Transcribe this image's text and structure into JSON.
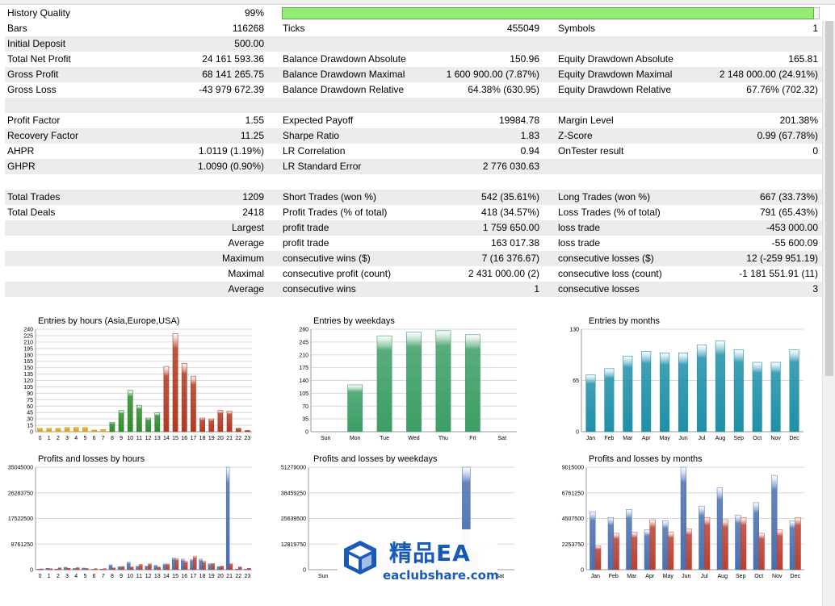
{
  "report": {
    "history_quality": {
      "label": "History Quality",
      "value": "99%",
      "fraction": 0.99
    },
    "rows": [
      {
        "shade": false,
        "c": [
          [
            "Bars",
            "116268"
          ],
          [
            "Ticks",
            "455049"
          ],
          [
            "Symbols",
            "1"
          ]
        ]
      },
      {
        "shade": true,
        "c": [
          [
            "Initial Deposit",
            "500.00"
          ],
          [
            "",
            ""
          ],
          [
            "",
            ""
          ]
        ]
      },
      {
        "shade": false,
        "c": [
          [
            "Total Net Profit",
            "24 161 593.36"
          ],
          [
            "Balance Drawdown Absolute",
            "150.96"
          ],
          [
            "Equity Drawdown Absolute",
            "165.81"
          ]
        ]
      },
      {
        "shade": true,
        "c": [
          [
            "Gross Profit",
            "68 141 265.75"
          ],
          [
            "Balance Drawdown Maximal",
            "1 600 900.00 (7.87%)"
          ],
          [
            "Equity Drawdown Maximal",
            "2 148 000.00 (24.91%)"
          ]
        ]
      },
      {
        "shade": false,
        "c": [
          [
            "Gross Loss",
            "-43 979 672.39"
          ],
          [
            "Balance Drawdown Relative",
            "64.38% (630.95)"
          ],
          [
            "Equity Drawdown Relative",
            "67.76% (702.32)"
          ]
        ]
      },
      {
        "shade": true,
        "blank": true,
        "c": []
      },
      {
        "shade": false,
        "c": [
          [
            "Profit Factor",
            "1.55"
          ],
          [
            "Expected Payoff",
            "19984.78"
          ],
          [
            "Margin Level",
            "201.38%"
          ]
        ]
      },
      {
        "shade": true,
        "c": [
          [
            "Recovery Factor",
            "11.25"
          ],
          [
            "Sharpe Ratio",
            "1.83"
          ],
          [
            "Z-Score",
            "0.99 (67.78%)"
          ]
        ]
      },
      {
        "shade": false,
        "c": [
          [
            "AHPR",
            "1.0119 (1.19%)"
          ],
          [
            "LR Correlation",
            "0.94"
          ],
          [
            "OnTester result",
            "0"
          ]
        ]
      },
      {
        "shade": true,
        "c": [
          [
            "GHPR",
            "1.0090 (0.90%)"
          ],
          [
            "LR Standard Error",
            "2 776 030.63"
          ],
          [
            "",
            ""
          ]
        ]
      },
      {
        "shade": false,
        "blank": true,
        "c": []
      },
      {
        "shade": true,
        "c": [
          [
            "Total Trades",
            "1209"
          ],
          [
            "Short Trades (won %)",
            "542 (35.61%)"
          ],
          [
            "Long Trades (won %)",
            "667 (33.73%)"
          ]
        ]
      },
      {
        "shade": false,
        "c": [
          [
            "Total Deals",
            "2418"
          ],
          [
            "Profit Trades (% of total)",
            "418 (34.57%)"
          ],
          [
            "Loss Trades (% of total)",
            "791 (65.43%)"
          ]
        ]
      },
      {
        "shade": true,
        "c": [
          [
            "",
            "Largest"
          ],
          [
            "profit trade",
            "1 759 650.00"
          ],
          [
            "loss trade",
            "-453 000.00"
          ]
        ]
      },
      {
        "shade": false,
        "c": [
          [
            "",
            "Average"
          ],
          [
            "profit trade",
            "163 017.38"
          ],
          [
            "loss trade",
            "-55 600.09"
          ]
        ]
      },
      {
        "shade": true,
        "c": [
          [
            "",
            "Maximum"
          ],
          [
            "consecutive wins ($)",
            "7 (16 376.67)"
          ],
          [
            "consecutive losses ($)",
            "12 (-259 951.19)"
          ]
        ]
      },
      {
        "shade": false,
        "c": [
          [
            "",
            "Maximal"
          ],
          [
            "consecutive profit (count)",
            "2 431 000.00 (2)"
          ],
          [
            "consecutive loss (count)",
            "-1 181 551.91 (11)"
          ]
        ]
      },
      {
        "shade": true,
        "c": [
          [
            "",
            "Average"
          ],
          [
            "consecutive wins",
            "1"
          ],
          [
            "consecutive losses",
            "3"
          ]
        ]
      }
    ]
  },
  "colors": {
    "hours_asia": "#d9a21b",
    "hours_europe": "#2e8b2e",
    "hours_usa": "#b03a22",
    "weekday_bar": "#3c9e66",
    "month_bar": "#1f8fa8",
    "profit_bar": "#4a6fb0",
    "loss_bar": "#b84030"
  },
  "watermark": {
    "big": "精品EA",
    "small": "eaclubshare.com"
  },
  "chart_data": [
    {
      "type": "bar",
      "title": "Entries by hours (Asia,Europe,USA)",
      "categories": [
        "0",
        "1",
        "2",
        "3",
        "4",
        "5",
        "6",
        "7",
        "8",
        "9",
        "10",
        "11",
        "12",
        "13",
        "14",
        "15",
        "16",
        "17",
        "18",
        "19",
        "20",
        "21",
        "22",
        "23"
      ],
      "values": [
        8,
        8,
        8,
        10,
        10,
        10,
        4,
        5,
        22,
        50,
        97,
        62,
        32,
        44,
        153,
        230,
        160,
        130,
        32,
        30,
        50,
        48,
        8,
        3
      ],
      "ylim": [
        0,
        240
      ],
      "yticks": [
        "0",
        "15",
        "30",
        "45",
        "60",
        "75",
        "90",
        "105",
        "120",
        "135",
        "150",
        "165",
        "180",
        "195",
        "210",
        "225",
        "240"
      ],
      "yticks_vals": [
        0,
        15,
        30,
        45,
        60,
        75,
        90,
        105,
        120,
        135,
        150,
        165,
        180,
        195,
        210,
        225,
        240
      ],
      "grid": true
    },
    {
      "type": "bar",
      "title": "Entries by weekdays",
      "categories": [
        "Sun",
        "Mon",
        "Tue",
        "Wed",
        "Thu",
        "Fri",
        "Sat"
      ],
      "values": [
        0,
        128,
        262,
        272,
        276,
        265,
        0
      ],
      "ylim": [
        0,
        280
      ],
      "yticks": [
        "0",
        "35",
        "70",
        "105",
        "140",
        "175",
        "210",
        "245",
        "280"
      ],
      "yticks_vals": [
        0,
        35,
        70,
        105,
        140,
        175,
        210,
        245,
        280
      ],
      "grid": true
    },
    {
      "type": "bar",
      "title": "Entries by months",
      "categories": [
        "Jan",
        "Feb",
        "Mar",
        "Apr",
        "May",
        "Jun",
        "Jul",
        "Aug",
        "Sep",
        "Oct",
        "Nov",
        "Dec"
      ],
      "values": [
        72,
        80,
        96,
        102,
        100,
        100,
        110,
        115,
        104,
        88,
        88,
        104
      ],
      "ylim": [
        0,
        130
      ],
      "yticks": [
        "0",
        "65",
        "130"
      ],
      "yticks_vals": [
        0,
        65,
        130
      ],
      "grid": true
    },
    {
      "type": "bar",
      "title": "Profits and losses by hours",
      "categories": [
        "0",
        "1",
        "2",
        "3",
        "4",
        "5",
        "6",
        "7",
        "8",
        "9",
        "10",
        "11",
        "12",
        "13",
        "14",
        "15",
        "16",
        "17",
        "18",
        "19",
        "20",
        "21",
        "22",
        "23"
      ],
      "series": [
        {
          "name": "profit",
          "values": [
            300000,
            700000,
            300000,
            1200000,
            600000,
            800000,
            200000,
            300000,
            2400000,
            1500000,
            3700000,
            1700000,
            1800000,
            2100000,
            2800000,
            5800000,
            5200000,
            5100000,
            5200000,
            2900000,
            1500000,
            50450000,
            300000,
            300000
          ]
        },
        {
          "name": "loss",
          "values": [
            400000,
            500000,
            900000,
            700000,
            1000000,
            600000,
            500000,
            500000,
            900000,
            1600000,
            1400000,
            2600000,
            2900000,
            1300000,
            2800000,
            5400000,
            4100000,
            6700000,
            4100000,
            3100000,
            1800000,
            3000000,
            1400000,
            700000
          ]
        }
      ],
      "ylim": [
        0,
        50450000
      ],
      "yticks": [
        "0",
        "8761250",
        "17522500",
        "26283750",
        "35045000"
      ],
      "yticks_vals": [
        0,
        12612500,
        25225000,
        37837500,
        50450000
      ],
      "grid": true
    },
    {
      "type": "bar",
      "title": "Profits and losses by weekdays",
      "categories": [
        "Sun",
        "Mon",
        "Tue",
        "Wed",
        "Thu",
        "Fri",
        "Sat"
      ],
      "series": [
        {
          "name": "profit",
          "values": [
            0,
            6500000,
            10000000,
            13000000,
            13500000,
            51279000,
            0
          ]
        },
        {
          "name": "loss",
          "values": [
            0,
            4800000,
            7500000,
            9000000,
            8800000,
            10500000,
            0
          ]
        }
      ],
      "ylim": [
        0,
        51279000
      ],
      "yticks": [
        "0",
        "12819750",
        "25639500",
        "38459250",
        "51279000"
      ],
      "yticks_vals": [
        0,
        12819750,
        25639500,
        38459250,
        51279000
      ],
      "grid": true
    },
    {
      "type": "bar",
      "title": "Profits and losses by months",
      "categories": [
        "Jan",
        "Feb",
        "Mar",
        "Apr",
        "May",
        "Jun",
        "Jul",
        "Aug",
        "Sep",
        "Oct",
        "Nov",
        "Dec"
      ],
      "series": [
        {
          "name": "profit",
          "values": [
            5100000,
            4600000,
            5300000,
            3500000,
            4300000,
            9015000,
            5600000,
            7200000,
            4800000,
            5900000,
            8300000,
            4300000
          ]
        },
        {
          "name": "loss",
          "values": [
            2100000,
            3200000,
            3300000,
            4400000,
            3300000,
            3600000,
            4600000,
            4400000,
            4600000,
            3200000,
            3500000,
            4600000
          ]
        }
      ],
      "ylim": [
        0,
        9015000
      ],
      "yticks": [
        "0",
        "2253750",
        "4507500",
        "6761250",
        "9015000"
      ],
      "yticks_vals": [
        0,
        2253750,
        4507500,
        6761250,
        9015000
      ],
      "grid": true
    }
  ]
}
